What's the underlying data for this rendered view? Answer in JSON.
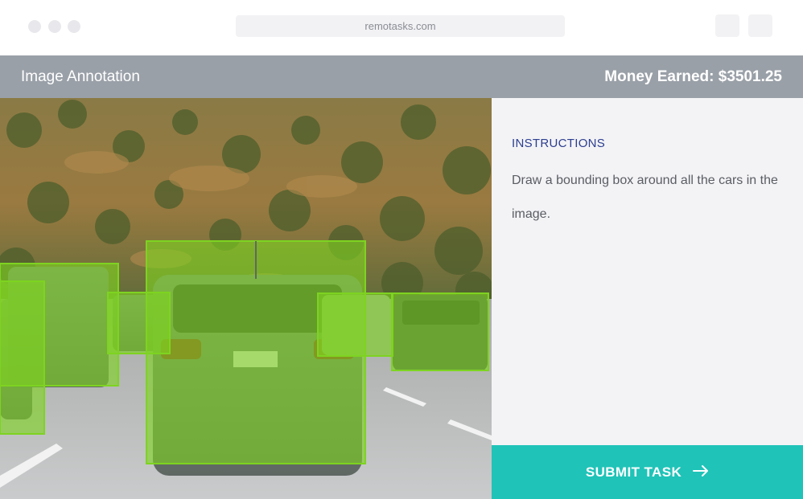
{
  "browser": {
    "url": "remotasks.com"
  },
  "header": {
    "title": "Image Annotation",
    "earnings": "Money Earned: $3501.25"
  },
  "instructions": {
    "heading": "INSTRUCTIONS",
    "text": "Draw a bounding box around all the cars in the image."
  },
  "submit": {
    "label": "SUBMIT TASK",
    "icon": "arrow-right-icon"
  },
  "colors": {
    "accent": "#1fc3b8",
    "bounding_box": "#7ed321",
    "header_bg": "#9aa0a8",
    "instruction_heading": "#2c3e8f"
  }
}
